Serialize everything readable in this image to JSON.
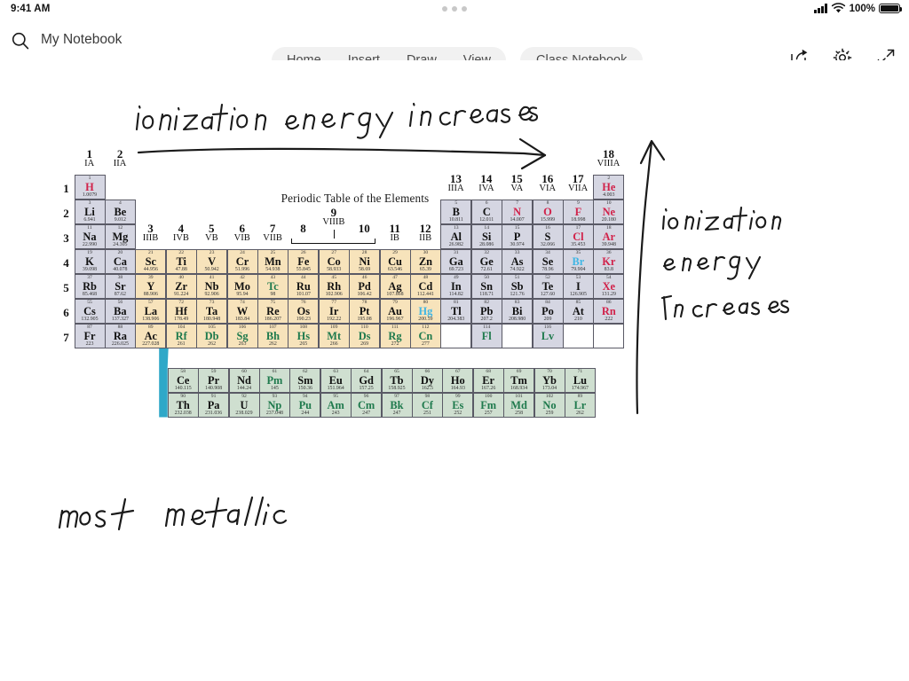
{
  "status_bar": {
    "time": "9:41 AM",
    "battery_percent": "100%",
    "signal_icon": "cellular-signal-icon",
    "wifi_icon": "wifi-icon",
    "battery_icon": "battery-full-icon",
    "grabber_icon": "multitask-dots-icon"
  },
  "header": {
    "search_icon": "search-icon",
    "notebook_title": "My Notebook",
    "tabs": [
      {
        "label": "Home",
        "name": "tab-home"
      },
      {
        "label": "Insert",
        "name": "tab-insert"
      },
      {
        "label": "Draw",
        "name": "tab-draw"
      },
      {
        "label": "View",
        "name": "tab-view"
      }
    ],
    "class_notebook_tab": "Class Notebook",
    "actions": [
      {
        "name": "share-icon"
      },
      {
        "name": "gear-icon"
      },
      {
        "name": "collapse-icon"
      }
    ]
  },
  "sidebar": {
    "back_button_icon": "chevron-left-icon",
    "back_button_color": "#7719aa"
  },
  "ink_annotations": [
    {
      "name": "ink-note-top",
      "text": "ionization energy increases",
      "direction": "horizontal-right-arrow"
    },
    {
      "name": "ink-note-right",
      "text": "ionization energy increases",
      "direction": "vertical-up-arrow"
    },
    {
      "name": "ink-note-bottom-left",
      "text": "most metallic",
      "direction": "none"
    }
  ],
  "periodic_table": {
    "title": "Periodic Table of the Elements",
    "groups": [
      {
        "num": "1",
        "roman": "IA"
      },
      {
        "num": "2",
        "roman": "IIA"
      },
      {
        "num": "3",
        "roman": "IIIB"
      },
      {
        "num": "4",
        "roman": "IVB"
      },
      {
        "num": "5",
        "roman": "VB"
      },
      {
        "num": "6",
        "roman": "VIB"
      },
      {
        "num": "7",
        "roman": "VIIB"
      },
      {
        "num": "8",
        "roman": ""
      },
      {
        "num": "9",
        "roman": "VIIIB"
      },
      {
        "num": "10",
        "roman": ""
      },
      {
        "num": "11",
        "roman": "IB"
      },
      {
        "num": "12",
        "roman": "IIB"
      },
      {
        "num": "13",
        "roman": "IIIA"
      },
      {
        "num": "14",
        "roman": "IVA"
      },
      {
        "num": "15",
        "roman": "VA"
      },
      {
        "num": "16",
        "roman": "VIA"
      },
      {
        "num": "17",
        "roman": "VIIA"
      },
      {
        "num": "18",
        "roman": "VIIIA"
      }
    ],
    "periods": [
      "1",
      "2",
      "3",
      "4",
      "5",
      "6",
      "7"
    ],
    "legend_colors": {
      "main_group": "#d5d6e2",
      "transition": "#f7e3bb",
      "inner_transition": "#cfdfd0",
      "gas_text": "#d1224a",
      "liquid_text": "#3fb6e4",
      "synthetic_text": "#1f7a4d",
      "connector": "#2fa8c8"
    },
    "elements": [
      {
        "z": "1",
        "sym": "H",
        "mass": "1.0079",
        "row": 1,
        "col": 1,
        "bg": "s",
        "tc": "red"
      },
      {
        "z": "2",
        "sym": "He",
        "mass": "4.003",
        "row": 1,
        "col": 18,
        "bg": "s",
        "tc": "red"
      },
      {
        "z": "3",
        "sym": "Li",
        "mass": "6.941",
        "row": 2,
        "col": 1,
        "bg": "s",
        "tc": ""
      },
      {
        "z": "4",
        "sym": "Be",
        "mass": "9.012",
        "row": 2,
        "col": 2,
        "bg": "s",
        "tc": ""
      },
      {
        "z": "5",
        "sym": "B",
        "mass": "10.811",
        "row": 2,
        "col": 13,
        "bg": "s",
        "tc": ""
      },
      {
        "z": "6",
        "sym": "C",
        "mass": "12.011",
        "row": 2,
        "col": 14,
        "bg": "s",
        "tc": ""
      },
      {
        "z": "7",
        "sym": "N",
        "mass": "14.007",
        "row": 2,
        "col": 15,
        "bg": "s",
        "tc": "red"
      },
      {
        "z": "8",
        "sym": "O",
        "mass": "15.999",
        "row": 2,
        "col": 16,
        "bg": "s",
        "tc": "red"
      },
      {
        "z": "9",
        "sym": "F",
        "mass": "18.998",
        "row": 2,
        "col": 17,
        "bg": "s",
        "tc": "red"
      },
      {
        "z": "10",
        "sym": "Ne",
        "mass": "20.180",
        "row": 2,
        "col": 18,
        "bg": "s",
        "tc": "red"
      },
      {
        "z": "11",
        "sym": "Na",
        "mass": "22.990",
        "row": 3,
        "col": 1,
        "bg": "s",
        "tc": ""
      },
      {
        "z": "12",
        "sym": "Mg",
        "mass": "24.305",
        "row": 3,
        "col": 2,
        "bg": "s",
        "tc": ""
      },
      {
        "z": "13",
        "sym": "Al",
        "mass": "26.982",
        "row": 3,
        "col": 13,
        "bg": "s",
        "tc": ""
      },
      {
        "z": "14",
        "sym": "Si",
        "mass": "28.086",
        "row": 3,
        "col": 14,
        "bg": "s",
        "tc": ""
      },
      {
        "z": "15",
        "sym": "P",
        "mass": "30.974",
        "row": 3,
        "col": 15,
        "bg": "s",
        "tc": ""
      },
      {
        "z": "16",
        "sym": "S",
        "mass": "32.066",
        "row": 3,
        "col": 16,
        "bg": "s",
        "tc": ""
      },
      {
        "z": "17",
        "sym": "Cl",
        "mass": "35.453",
        "row": 3,
        "col": 17,
        "bg": "s",
        "tc": "red"
      },
      {
        "z": "18",
        "sym": "Ar",
        "mass": "39.948",
        "row": 3,
        "col": 18,
        "bg": "s",
        "tc": "red"
      },
      {
        "z": "19",
        "sym": "K",
        "mass": "39.098",
        "row": 4,
        "col": 1,
        "bg": "s",
        "tc": ""
      },
      {
        "z": "20",
        "sym": "Ca",
        "mass": "40.078",
        "row": 4,
        "col": 2,
        "bg": "s",
        "tc": ""
      },
      {
        "z": "21",
        "sym": "Sc",
        "mass": "44.956",
        "row": 4,
        "col": 3,
        "bg": "d",
        "tc": ""
      },
      {
        "z": "22",
        "sym": "Ti",
        "mass": "47.88",
        "row": 4,
        "col": 4,
        "bg": "d",
        "tc": ""
      },
      {
        "z": "23",
        "sym": "V",
        "mass": "50.942",
        "row": 4,
        "col": 5,
        "bg": "d",
        "tc": ""
      },
      {
        "z": "24",
        "sym": "Cr",
        "mass": "51.996",
        "row": 4,
        "col": 6,
        "bg": "d",
        "tc": ""
      },
      {
        "z": "25",
        "sym": "Mn",
        "mass": "54.938",
        "row": 4,
        "col": 7,
        "bg": "d",
        "tc": ""
      },
      {
        "z": "26",
        "sym": "Fe",
        "mass": "55.845",
        "row": 4,
        "col": 8,
        "bg": "d",
        "tc": ""
      },
      {
        "z": "27",
        "sym": "Co",
        "mass": "58.933",
        "row": 4,
        "col": 9,
        "bg": "d",
        "tc": ""
      },
      {
        "z": "28",
        "sym": "Ni",
        "mass": "58.69",
        "row": 4,
        "col": 10,
        "bg": "d",
        "tc": ""
      },
      {
        "z": "29",
        "sym": "Cu",
        "mass": "63.546",
        "row": 4,
        "col": 11,
        "bg": "d",
        "tc": ""
      },
      {
        "z": "30",
        "sym": "Zn",
        "mass": "65.39",
        "row": 4,
        "col": 12,
        "bg": "d",
        "tc": ""
      },
      {
        "z": "31",
        "sym": "Ga",
        "mass": "69.723",
        "row": 4,
        "col": 13,
        "bg": "s",
        "tc": ""
      },
      {
        "z": "32",
        "sym": "Ge",
        "mass": "72.61",
        "row": 4,
        "col": 14,
        "bg": "s",
        "tc": ""
      },
      {
        "z": "33",
        "sym": "As",
        "mass": "74.922",
        "row": 4,
        "col": 15,
        "bg": "s",
        "tc": ""
      },
      {
        "z": "34",
        "sym": "Se",
        "mass": "78.96",
        "row": 4,
        "col": 16,
        "bg": "s",
        "tc": ""
      },
      {
        "z": "35",
        "sym": "Br",
        "mass": "79.904",
        "row": 4,
        "col": 17,
        "bg": "s",
        "tc": "blue"
      },
      {
        "z": "36",
        "sym": "Kr",
        "mass": "83.8",
        "row": 4,
        "col": 18,
        "bg": "s",
        "tc": "red"
      },
      {
        "z": "37",
        "sym": "Rb",
        "mass": "85.468",
        "row": 5,
        "col": 1,
        "bg": "s",
        "tc": ""
      },
      {
        "z": "38",
        "sym": "Sr",
        "mass": "87.62",
        "row": 5,
        "col": 2,
        "bg": "s",
        "tc": ""
      },
      {
        "z": "39",
        "sym": "Y",
        "mass": "88.906",
        "row": 5,
        "col": 3,
        "bg": "d",
        "tc": ""
      },
      {
        "z": "40",
        "sym": "Zr",
        "mass": "91.224",
        "row": 5,
        "col": 4,
        "bg": "d",
        "tc": ""
      },
      {
        "z": "41",
        "sym": "Nb",
        "mass": "92.906",
        "row": 5,
        "col": 5,
        "bg": "d",
        "tc": ""
      },
      {
        "z": "42",
        "sym": "Mo",
        "mass": "95.94",
        "row": 5,
        "col": 6,
        "bg": "d",
        "tc": ""
      },
      {
        "z": "43",
        "sym": "Tc",
        "mass": "98",
        "row": 5,
        "col": 7,
        "bg": "d",
        "tc": "green"
      },
      {
        "z": "44",
        "sym": "Ru",
        "mass": "101.07",
        "row": 5,
        "col": 8,
        "bg": "d",
        "tc": ""
      },
      {
        "z": "45",
        "sym": "Rh",
        "mass": "102.906",
        "row": 5,
        "col": 9,
        "bg": "d",
        "tc": ""
      },
      {
        "z": "46",
        "sym": "Pd",
        "mass": "106.42",
        "row": 5,
        "col": 10,
        "bg": "d",
        "tc": ""
      },
      {
        "z": "47",
        "sym": "Ag",
        "mass": "107.868",
        "row": 5,
        "col": 11,
        "bg": "d",
        "tc": ""
      },
      {
        "z": "48",
        "sym": "Cd",
        "mass": "112.441",
        "row": 5,
        "col": 12,
        "bg": "d",
        "tc": ""
      },
      {
        "z": "49",
        "sym": "In",
        "mass": "114.82",
        "row": 5,
        "col": 13,
        "bg": "s",
        "tc": ""
      },
      {
        "z": "50",
        "sym": "Sn",
        "mass": "118.71",
        "row": 5,
        "col": 14,
        "bg": "s",
        "tc": ""
      },
      {
        "z": "51",
        "sym": "Sb",
        "mass": "121.76",
        "row": 5,
        "col": 15,
        "bg": "s",
        "tc": ""
      },
      {
        "z": "52",
        "sym": "Te",
        "mass": "127.60",
        "row": 5,
        "col": 16,
        "bg": "s",
        "tc": ""
      },
      {
        "z": "53",
        "sym": "I",
        "mass": "126.905",
        "row": 5,
        "col": 17,
        "bg": "s",
        "tc": ""
      },
      {
        "z": "54",
        "sym": "Xe",
        "mass": "131.29",
        "row": 5,
        "col": 18,
        "bg": "s",
        "tc": "red"
      },
      {
        "z": "55",
        "sym": "Cs",
        "mass": "132.905",
        "row": 6,
        "col": 1,
        "bg": "s",
        "tc": ""
      },
      {
        "z": "56",
        "sym": "Ba",
        "mass": "137.327",
        "row": 6,
        "col": 2,
        "bg": "s",
        "tc": ""
      },
      {
        "z": "57",
        "sym": "La",
        "mass": "138.906",
        "row": 6,
        "col": 3,
        "bg": "d",
        "tc": ""
      },
      {
        "z": "72",
        "sym": "Hf",
        "mass": "178.49",
        "row": 6,
        "col": 4,
        "bg": "d",
        "tc": ""
      },
      {
        "z": "73",
        "sym": "Ta",
        "mass": "180.948",
        "row": 6,
        "col": 5,
        "bg": "d",
        "tc": ""
      },
      {
        "z": "74",
        "sym": "W",
        "mass": "183.84",
        "row": 6,
        "col": 6,
        "bg": "d",
        "tc": ""
      },
      {
        "z": "75",
        "sym": "Re",
        "mass": "186.207",
        "row": 6,
        "col": 7,
        "bg": "d",
        "tc": ""
      },
      {
        "z": "76",
        "sym": "Os",
        "mass": "190.23",
        "row": 6,
        "col": 8,
        "bg": "d",
        "tc": ""
      },
      {
        "z": "77",
        "sym": "Ir",
        "mass": "192.22",
        "row": 6,
        "col": 9,
        "bg": "d",
        "tc": ""
      },
      {
        "z": "78",
        "sym": "Pt",
        "mass": "195.08",
        "row": 6,
        "col": 10,
        "bg": "d",
        "tc": ""
      },
      {
        "z": "79",
        "sym": "Au",
        "mass": "196.967",
        "row": 6,
        "col": 11,
        "bg": "d",
        "tc": ""
      },
      {
        "z": "80",
        "sym": "Hg",
        "mass": "200.59",
        "row": 6,
        "col": 12,
        "bg": "d",
        "tc": "blue"
      },
      {
        "z": "81",
        "sym": "Tl",
        "mass": "204.383",
        "row": 6,
        "col": 13,
        "bg": "s",
        "tc": ""
      },
      {
        "z": "82",
        "sym": "Pb",
        "mass": "207.2",
        "row": 6,
        "col": 14,
        "bg": "s",
        "tc": ""
      },
      {
        "z": "83",
        "sym": "Bi",
        "mass": "208.980",
        "row": 6,
        "col": 15,
        "bg": "s",
        "tc": ""
      },
      {
        "z": "84",
        "sym": "Po",
        "mass": "209",
        "row": 6,
        "col": 16,
        "bg": "s",
        "tc": ""
      },
      {
        "z": "85",
        "sym": "At",
        "mass": "210",
        "row": 6,
        "col": 17,
        "bg": "s",
        "tc": ""
      },
      {
        "z": "86",
        "sym": "Rn",
        "mass": "222",
        "row": 6,
        "col": 18,
        "bg": "s",
        "tc": "red"
      },
      {
        "z": "87",
        "sym": "Fr",
        "mass": "223",
        "row": 7,
        "col": 1,
        "bg": "s",
        "tc": ""
      },
      {
        "z": "88",
        "sym": "Ra",
        "mass": "226.025",
        "row": 7,
        "col": 2,
        "bg": "s",
        "tc": ""
      },
      {
        "z": "89",
        "sym": "Ac",
        "mass": "227.028",
        "row": 7,
        "col": 3,
        "bg": "d",
        "tc": ""
      },
      {
        "z": "104",
        "sym": "Rf",
        "mass": "261",
        "row": 7,
        "col": 4,
        "bg": "d",
        "tc": "green"
      },
      {
        "z": "105",
        "sym": "Db",
        "mass": "262",
        "row": 7,
        "col": 5,
        "bg": "d",
        "tc": "green"
      },
      {
        "z": "106",
        "sym": "Sg",
        "mass": "263",
        "row": 7,
        "col": 6,
        "bg": "d",
        "tc": "green"
      },
      {
        "z": "107",
        "sym": "Bh",
        "mass": "262",
        "row": 7,
        "col": 7,
        "bg": "d",
        "tc": "green"
      },
      {
        "z": "108",
        "sym": "Hs",
        "mass": "265",
        "row": 7,
        "col": 8,
        "bg": "d",
        "tc": "green"
      },
      {
        "z": "109",
        "sym": "Mt",
        "mass": "266",
        "row": 7,
        "col": 9,
        "bg": "d",
        "tc": "green"
      },
      {
        "z": "110",
        "sym": "Ds",
        "mass": "269",
        "row": 7,
        "col": 10,
        "bg": "d",
        "tc": "green"
      },
      {
        "z": "111",
        "sym": "Rg",
        "mass": "272",
        "row": 7,
        "col": 11,
        "bg": "d",
        "tc": "green"
      },
      {
        "z": "112",
        "sym": "Cn",
        "mass": "277",
        "row": 7,
        "col": 12,
        "bg": "d",
        "tc": "green"
      },
      {
        "z": "",
        "sym": "",
        "mass": "",
        "row": 7,
        "col": 13,
        "bg": "e",
        "tc": ""
      },
      {
        "z": "114",
        "sym": "Fl",
        "mass": "",
        "row": 7,
        "col": 14,
        "bg": "s",
        "tc": "green"
      },
      {
        "z": "",
        "sym": "",
        "mass": "",
        "row": 7,
        "col": 15,
        "bg": "e",
        "tc": ""
      },
      {
        "z": "116",
        "sym": "Lv",
        "mass": "",
        "row": 7,
        "col": 16,
        "bg": "s",
        "tc": "green"
      },
      {
        "z": "",
        "sym": "",
        "mass": "",
        "row": 7,
        "col": 17,
        "bg": "e",
        "tc": ""
      },
      {
        "z": "",
        "sym": "",
        "mass": "",
        "row": 7,
        "col": 18,
        "bg": "e",
        "tc": ""
      }
    ],
    "lanthanides": [
      {
        "z": "58",
        "sym": "Ce",
        "mass": "140.115",
        "tc": ""
      },
      {
        "z": "59",
        "sym": "Pr",
        "mass": "140.908",
        "tc": ""
      },
      {
        "z": "60",
        "sym": "Nd",
        "mass": "144.24",
        "tc": ""
      },
      {
        "z": "61",
        "sym": "Pm",
        "mass": "145",
        "tc": "green"
      },
      {
        "z": "62",
        "sym": "Sm",
        "mass": "150.36",
        "tc": ""
      },
      {
        "z": "63",
        "sym": "Eu",
        "mass": "151.964",
        "tc": ""
      },
      {
        "z": "64",
        "sym": "Gd",
        "mass": "157.25",
        "tc": ""
      },
      {
        "z": "65",
        "sym": "Tb",
        "mass": "158.925",
        "tc": ""
      },
      {
        "z": "66",
        "sym": "Dy",
        "mass": "162.5",
        "tc": ""
      },
      {
        "z": "67",
        "sym": "Ho",
        "mass": "164.93",
        "tc": ""
      },
      {
        "z": "68",
        "sym": "Er",
        "mass": "167.26",
        "tc": ""
      },
      {
        "z": "69",
        "sym": "Tm",
        "mass": "168.934",
        "tc": ""
      },
      {
        "z": "70",
        "sym": "Yb",
        "mass": "173.04",
        "tc": ""
      },
      {
        "z": "71",
        "sym": "Lu",
        "mass": "174.967",
        "tc": ""
      }
    ],
    "actinides": [
      {
        "z": "90",
        "sym": "Th",
        "mass": "232.038",
        "tc": ""
      },
      {
        "z": "91",
        "sym": "Pa",
        "mass": "231.036",
        "tc": ""
      },
      {
        "z": "92",
        "sym": "U",
        "mass": "238.029",
        "tc": ""
      },
      {
        "z": "93",
        "sym": "Np",
        "mass": "237.048",
        "tc": "green"
      },
      {
        "z": "94",
        "sym": "Pu",
        "mass": "244",
        "tc": "green"
      },
      {
        "z": "95",
        "sym": "Am",
        "mass": "243",
        "tc": "green"
      },
      {
        "z": "96",
        "sym": "Cm",
        "mass": "247",
        "tc": "green"
      },
      {
        "z": "97",
        "sym": "Bk",
        "mass": "247",
        "tc": "green"
      },
      {
        "z": "98",
        "sym": "Cf",
        "mass": "251",
        "tc": "green"
      },
      {
        "z": "99",
        "sym": "Es",
        "mass": "252",
        "tc": "green"
      },
      {
        "z": "100",
        "sym": "Fm",
        "mass": "257",
        "tc": "green"
      },
      {
        "z": "101",
        "sym": "Md",
        "mass": "258",
        "tc": "green"
      },
      {
        "z": "102",
        "sym": "No",
        "mass": "259",
        "tc": "green"
      },
      {
        "z": "89",
        "sym": "Lr",
        "mass": "262",
        "tc": "green"
      }
    ]
  }
}
